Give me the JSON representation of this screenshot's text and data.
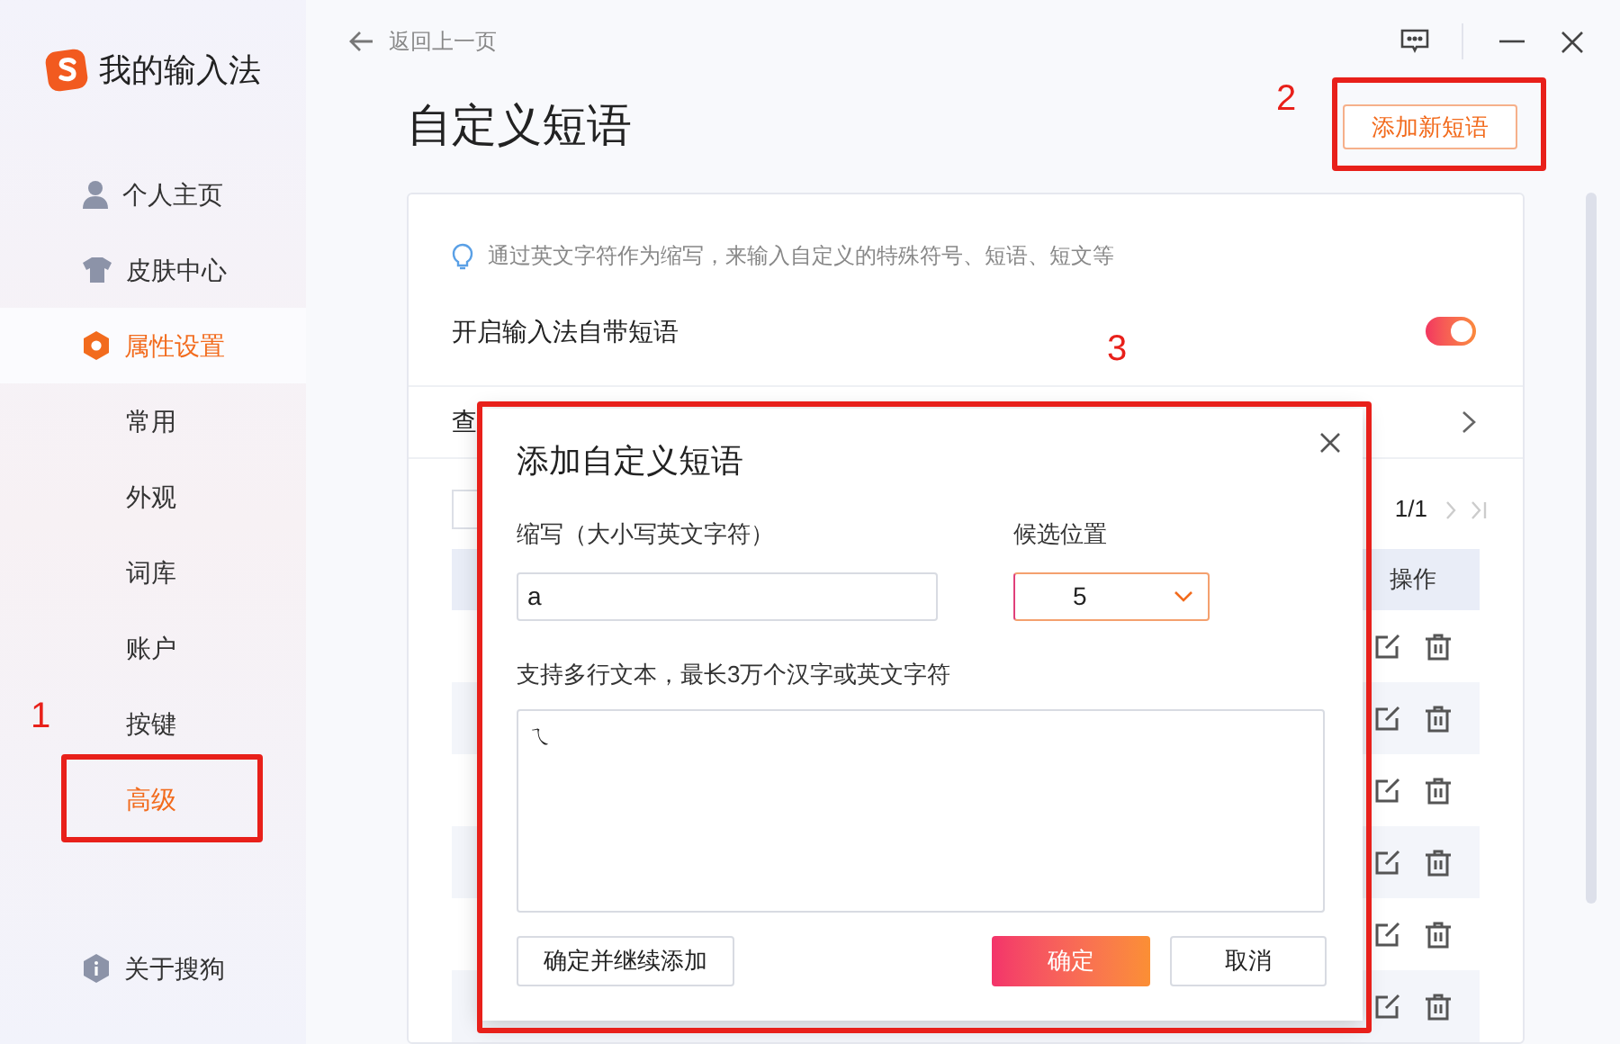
{
  "app": {
    "title": "我的输入法"
  },
  "sidebar": {
    "items": [
      {
        "label": "个人主页",
        "kind": "person",
        "selected": false
      },
      {
        "label": "皮肤中心",
        "kind": "shirt",
        "selected": false
      },
      {
        "label": "属性设置",
        "kind": "hexagon",
        "selected": true,
        "children": [
          {
            "label": "常用",
            "selected": false
          },
          {
            "label": "外观",
            "selected": false
          },
          {
            "label": "词库",
            "selected": false
          },
          {
            "label": "账户",
            "selected": false
          },
          {
            "label": "按键",
            "selected": false
          },
          {
            "label": "高级",
            "selected": true
          }
        ]
      }
    ],
    "footer": {
      "label": "关于搜狗"
    }
  },
  "topbar": {
    "back": "返回上一页"
  },
  "page": {
    "title": "自定义短语",
    "add_button": "添加新短语",
    "tip": "通过英文字符作为缩写，来输入自定义的特殊符号、短语、短文等",
    "toggle": {
      "label": "开启输入法自带短语",
      "on": true
    },
    "link_row": {
      "label": "查"
    },
    "pagination": "1/1",
    "table": {
      "action_header": "操作",
      "rows": [
        {
          "kind": "editable"
        },
        {
          "kind": "editable"
        },
        {
          "kind": "editable"
        },
        {
          "kind": "editable"
        },
        {
          "kind": "editable"
        },
        {
          "kind": "editable"
        }
      ]
    }
  },
  "dialog": {
    "title": "添加自定义短语",
    "abbr_label": "缩写（大小写英文字符）",
    "abbr_value": "a",
    "position_label": "候选位置",
    "position_value": "5",
    "text_label": "支持多行文本，最长3万个汉字或英文字符",
    "text_value": "ㄟ",
    "continue_button": "确定并继续添加",
    "ok_button": "确定",
    "cancel_button": "取消"
  },
  "annotations": [
    {
      "label": "1"
    },
    {
      "label": "2"
    },
    {
      "label": "3"
    }
  ]
}
